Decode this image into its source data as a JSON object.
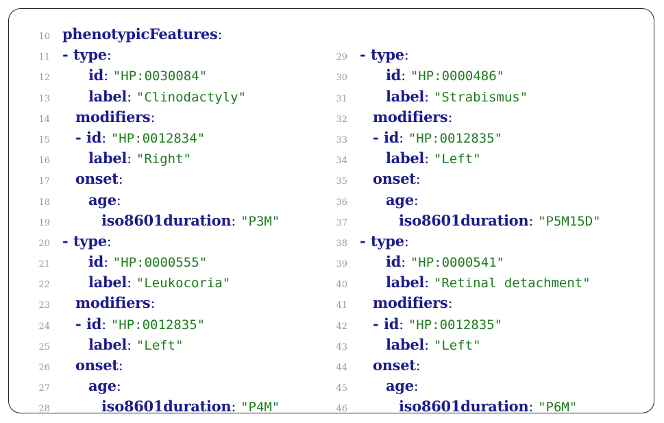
{
  "left_column": [
    {
      "num": "10",
      "indent": 0,
      "dash": "",
      "key": "phenotypicFeatures",
      "value": ""
    },
    {
      "num": "11",
      "indent": 0,
      "dash": "- ",
      "key": "type",
      "value": ""
    },
    {
      "num": "12",
      "indent": 3,
      "dash": "",
      "key": "id",
      "value": "\"HP:0030084\""
    },
    {
      "num": "13",
      "indent": 3,
      "dash": "",
      "key": "label",
      "value": "\"Clinodactyly\""
    },
    {
      "num": "14",
      "indent": 2,
      "dash": "",
      "key": "modifiers",
      "value": ""
    },
    {
      "num": "15",
      "indent": 2,
      "dash": "- ",
      "key": "id",
      "value": "\"HP:0012834\""
    },
    {
      "num": "16",
      "indent": 3,
      "dash": "",
      "key": "label",
      "value": "\"Right\""
    },
    {
      "num": "17",
      "indent": 2,
      "dash": "",
      "key": "onset",
      "value": ""
    },
    {
      "num": "18",
      "indent": 3,
      "dash": "",
      "key": "age",
      "value": ""
    },
    {
      "num": "19",
      "indent": 4,
      "dash": "",
      "key": "iso8601duration",
      "value": "\"P3M\""
    },
    {
      "num": "20",
      "indent": 0,
      "dash": "- ",
      "key": "type",
      "value": ""
    },
    {
      "num": "21",
      "indent": 3,
      "dash": "",
      "key": "id",
      "value": "\"HP:0000555\""
    },
    {
      "num": "22",
      "indent": 3,
      "dash": "",
      "key": "label",
      "value": "\"Leukocoria\""
    },
    {
      "num": "23",
      "indent": 2,
      "dash": "",
      "key": "modifiers",
      "value": ""
    },
    {
      "num": "24",
      "indent": 2,
      "dash": "- ",
      "key": "id",
      "value": "\"HP:0012835\""
    },
    {
      "num": "25",
      "indent": 3,
      "dash": "",
      "key": "label",
      "value": "\"Left\""
    },
    {
      "num": "26",
      "indent": 2,
      "dash": "",
      "key": "onset",
      "value": ""
    },
    {
      "num": "27",
      "indent": 3,
      "dash": "",
      "key": "age",
      "value": ""
    },
    {
      "num": "28",
      "indent": 4,
      "dash": "",
      "key": "iso8601duration",
      "value": "\"P4M\""
    }
  ],
  "right_column": [
    {
      "num": "29",
      "indent": 0,
      "dash": "- ",
      "key": "type",
      "value": ""
    },
    {
      "num": "30",
      "indent": 3,
      "dash": "",
      "key": "id",
      "value": "\"HP:0000486\""
    },
    {
      "num": "31",
      "indent": 3,
      "dash": "",
      "key": "label",
      "value": "\"Strabismus\""
    },
    {
      "num": "32",
      "indent": 2,
      "dash": "",
      "key": "modifiers",
      "value": ""
    },
    {
      "num": "33",
      "indent": 2,
      "dash": "- ",
      "key": "id",
      "value": "\"HP:0012835\""
    },
    {
      "num": "34",
      "indent": 3,
      "dash": "",
      "key": "label",
      "value": "\"Left\""
    },
    {
      "num": "35",
      "indent": 2,
      "dash": "",
      "key": "onset",
      "value": ""
    },
    {
      "num": "36",
      "indent": 3,
      "dash": "",
      "key": "age",
      "value": ""
    },
    {
      "num": "37",
      "indent": 4,
      "dash": "",
      "key": "iso8601duration",
      "value": "\"P5M15D\""
    },
    {
      "num": "38",
      "indent": 0,
      "dash": "- ",
      "key": "type",
      "value": ""
    },
    {
      "num": "39",
      "indent": 3,
      "dash": "",
      "key": "id",
      "value": "\"HP:0000541\""
    },
    {
      "num": "40",
      "indent": 3,
      "dash": "",
      "key": "label",
      "value": "\"Retinal detachment\""
    },
    {
      "num": "41",
      "indent": 2,
      "dash": "",
      "key": "modifiers",
      "value": ""
    },
    {
      "num": "42",
      "indent": 2,
      "dash": "- ",
      "key": "id",
      "value": "\"HP:0012835\""
    },
    {
      "num": "43",
      "indent": 3,
      "dash": "",
      "key": "label",
      "value": "\"Left\""
    },
    {
      "num": "44",
      "indent": 2,
      "dash": "",
      "key": "onset",
      "value": ""
    },
    {
      "num": "45",
      "indent": 3,
      "dash": "",
      "key": "age",
      "value": ""
    },
    {
      "num": "46",
      "indent": 4,
      "dash": "",
      "key": "iso8601duration",
      "value": "\"P6M\""
    }
  ],
  "colors": {
    "key": "#1c1c8c",
    "string": "#1f7a1f",
    "line_number": "#9a9a9a"
  }
}
